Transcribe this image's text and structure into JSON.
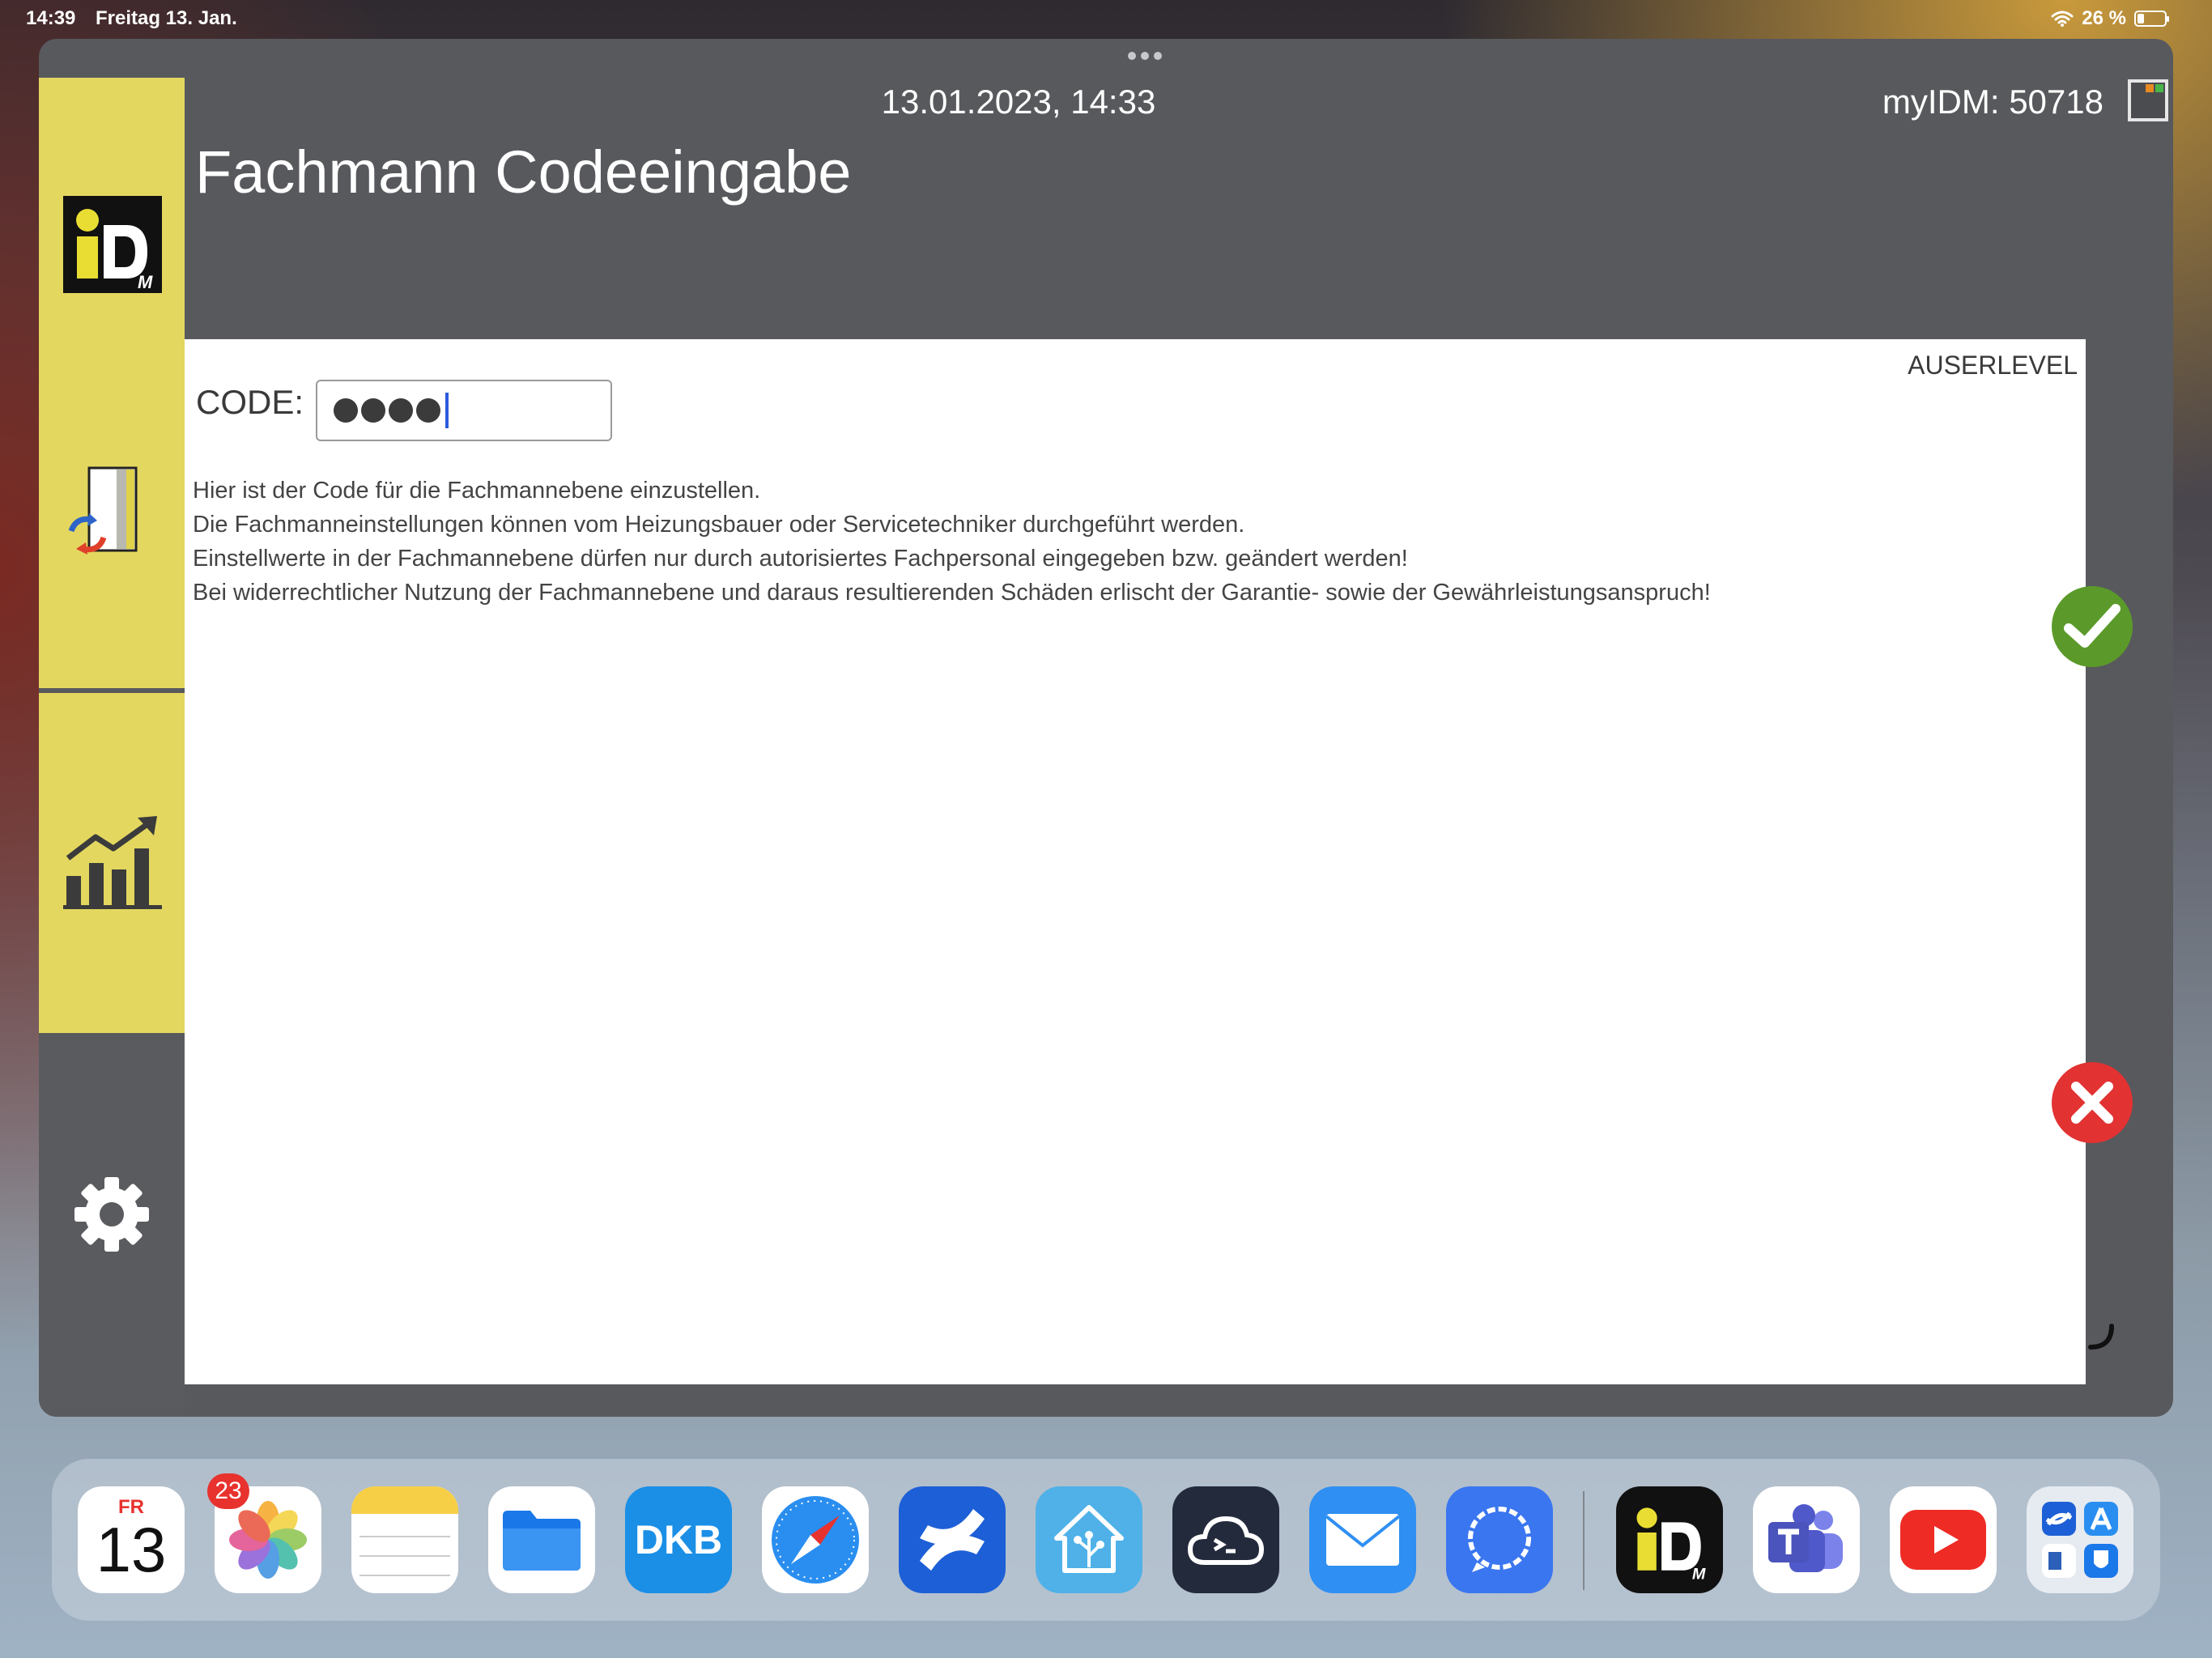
{
  "status_bar": {
    "time": "14:39",
    "date": "Freitag 13. Jan.",
    "battery": "26 %"
  },
  "window": {
    "datetime": "13.01.2023, 14:33",
    "device_id": "myIDM: 50718",
    "title": "Fachmann Codeeingabe"
  },
  "sidebar": {
    "items": [
      {
        "name": "idm-logo",
        "icon": "idm-logo-icon"
      },
      {
        "name": "file-transfer",
        "icon": "file-sync-icon"
      },
      {
        "name": "statistics",
        "icon": "bar-chart-icon"
      },
      {
        "name": "settings",
        "icon": "gear-icon"
      }
    ],
    "colors": {
      "accent": "#e3d75f",
      "dark": "#5a5b5f"
    }
  },
  "form": {
    "user_level": "AUSERLEVEL",
    "code_label": "CODE:",
    "code_masked_length": 4,
    "info_lines": [
      "Hier ist der Code für die Fachmannebene einzustellen.",
      "Die Fachmanneinstellungen können vom Heizungsbauer oder Servicetechniker durchgeführt werden.",
      "Einstellwerte in der Fachmannebene dürfen nur durch autorisiertes Fachpersonal eingegeben bzw. geändert werden!",
      "Bei widerrechtlicher Nutzung der Fachmannebene und daraus resultierenden Schäden erlischt der Garantie- sowie der Gewährleistungsanspruch!"
    ]
  },
  "actions": {
    "confirm_color": "#5b9a2a",
    "cancel_color": "#e23232"
  },
  "dock": {
    "calendar_day": "FR",
    "calendar_date": "13",
    "calendar_badge": "23",
    "dkb_label": "DKB",
    "apps": [
      "calendar",
      "photos",
      "notes",
      "files",
      "dkb",
      "safari",
      "confluence",
      "home-assistant",
      "termius",
      "mail",
      "signal",
      "idm",
      "teams",
      "youtube",
      "app-library"
    ]
  }
}
